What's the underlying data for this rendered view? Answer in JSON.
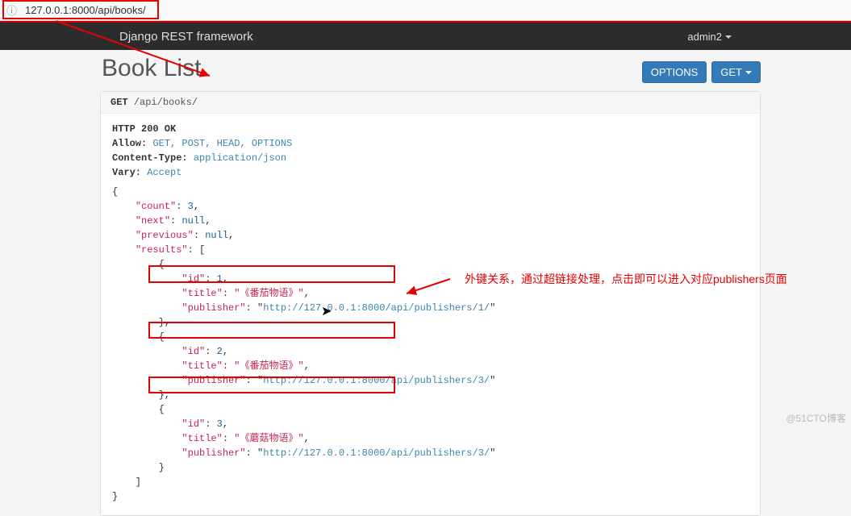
{
  "browser": {
    "url": "127.0.0.1:8000/api/books/"
  },
  "nav": {
    "brand": "Django REST framework",
    "user": "admin2"
  },
  "breadcrumb": {
    "last": "Book List"
  },
  "page": {
    "title": "Book List"
  },
  "buttons": {
    "options": "OPTIONS",
    "get": "GET"
  },
  "request": {
    "method": "GET",
    "path": "/api/books/"
  },
  "response": {
    "status_line": "HTTP 200 OK",
    "allow_label": "Allow:",
    "allow": "GET, POST, HEAD, OPTIONS",
    "ctype_label": "Content-Type:",
    "ctype": "application/json",
    "vary_label": "Vary:",
    "vary": "Accept"
  },
  "json": {
    "count": 3,
    "next": "null",
    "previous": "null",
    "results": [
      {
        "id": 1,
        "title": "《番茄物语》",
        "publisher": "http://127.0.0.1:8000/api/publishers/1/"
      },
      {
        "id": 2,
        "title": "《番茄物语》",
        "publisher": "http://127.0.0.1:8000/api/publishers/3/"
      },
      {
        "id": 3,
        "title": "《蘑菇物语》",
        "publisher": "http://127.0.0.1:8000/api/publishers/3/"
      }
    ]
  },
  "annotation": {
    "text": "外键关系，通过超链接处理，点击即可以进入对应publishers页面"
  },
  "watermark": "@51CTO博客"
}
